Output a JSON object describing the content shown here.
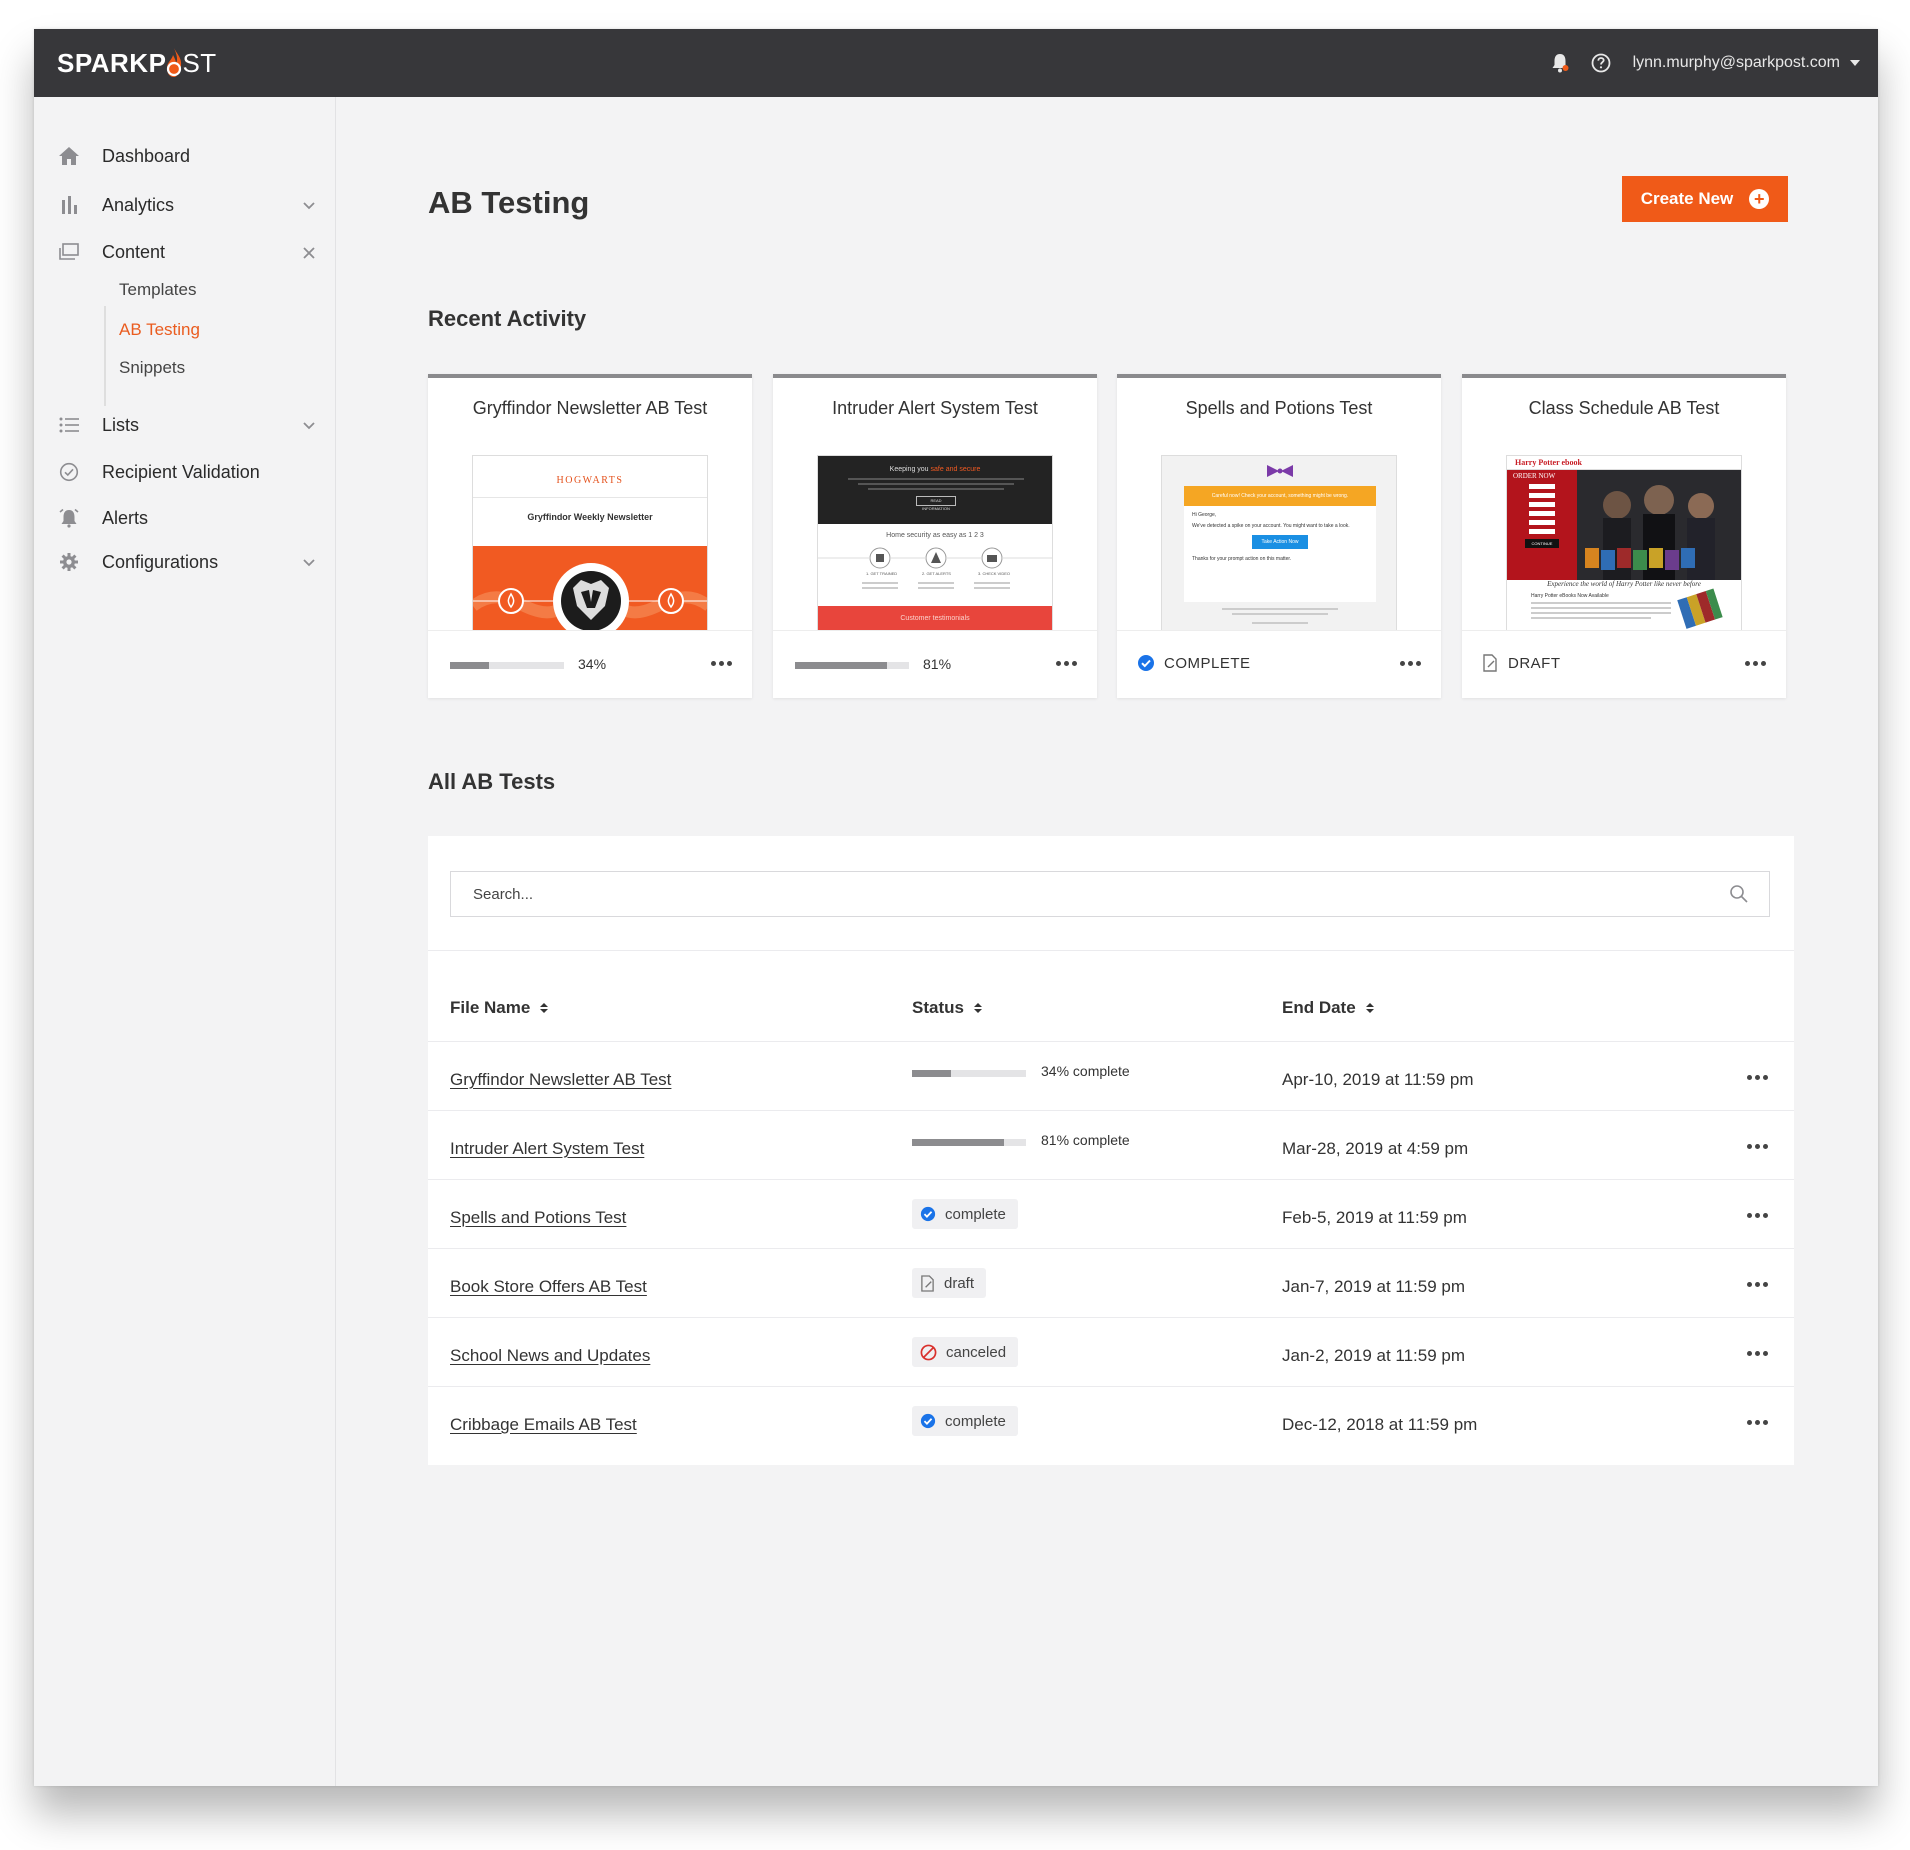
{
  "header": {
    "logo_left": "SPARKP",
    "logo_right": "ST",
    "user_email": "lynn.murphy@sparkpost.com",
    "icons": [
      "bell-icon",
      "help-icon"
    ]
  },
  "sidebar": {
    "items": [
      {
        "label": "Dashboard",
        "icon": "home-icon"
      },
      {
        "label": "Analytics",
        "icon": "bar-chart-icon"
      },
      {
        "label": "Content",
        "icon": "content-icon"
      },
      {
        "label": "Lists",
        "icon": "list-icon"
      },
      {
        "label": "Recipient Validation",
        "icon": "check-circle-icon"
      },
      {
        "label": "Alerts",
        "icon": "alarm-icon"
      },
      {
        "label": "Configurations",
        "icon": "gear-icon"
      }
    ],
    "content_sub": [
      "Templates",
      "AB Testing",
      "Snippets"
    ]
  },
  "page": {
    "title": "AB Testing",
    "create_label": "Create New",
    "recent_heading": "Recent Activity",
    "all_heading": "All AB Tests"
  },
  "cards": [
    {
      "title": "Gryffindor Newsletter AB Test",
      "progress": 34,
      "progress_label": "34%"
    },
    {
      "title": "Intruder Alert System Test",
      "progress": 81,
      "progress_label": "81%"
    },
    {
      "title": "Spells and Potions Test",
      "status": "COMPLETE"
    },
    {
      "title": "Class Schedule AB Test",
      "status": "DRAFT"
    }
  ],
  "thumbs": {
    "t1": {
      "brand": "HOGWARTS",
      "headline": "Gryffindor Weekly Newsletter"
    },
    "t2": {
      "headline_a": "Keeping you ",
      "headline_b": "safe and secure",
      "button": "READ INFORMATION",
      "mid": "Home security as easy as 1 2 3",
      "col1": "1. GET TRAINED",
      "col2": "2. GET ALERTS",
      "col3": "3. CHECK VIDEO",
      "footer": "Customer testimonials"
    },
    "t3": {
      "banner": "Careful now! Check your account, something might be wrong.",
      "greeting": "Hi George,",
      "body": "We've detected a spike on your account. You might want to take a look.",
      "button": "Take Action Now",
      "thanks": "Thanks for your prompt action on this matter."
    },
    "t4": {
      "brand": "Harry Potter ebook",
      "order": "ORDER NOW",
      "continue": "CONTINUE",
      "tagline": "Experience the world of Harry Potter like never before",
      "sub": "Harry Potter eBooks Now Available"
    }
  },
  "search": {
    "placeholder": "Search..."
  },
  "table": {
    "columns": [
      "File Name",
      "Status",
      "End Date"
    ],
    "rows": [
      {
        "name": "Gryffindor Newsletter AB Test",
        "progress": 34,
        "status_text": "34% complete",
        "end_date": "Apr-10, 2019 at 11:59 pm"
      },
      {
        "name": "Intruder Alert System Test",
        "progress": 81,
        "status_text": "81% complete",
        "end_date": "Mar-28, 2019 at 4:59 pm"
      },
      {
        "name": "Spells and Potions Test",
        "status": "complete",
        "end_date": "Feb-5, 2019 at 11:59 pm"
      },
      {
        "name": "Book Store Offers AB Test",
        "status": "draft",
        "end_date": "Jan-7, 2019 at 11:59 pm"
      },
      {
        "name": "School News and Updates",
        "status": "canceled",
        "end_date": "Jan-2, 2019 at 11:59 pm"
      },
      {
        "name": "Cribbage Emails AB Test",
        "status": "complete",
        "end_date": "Dec-12, 2018 at 11:59 pm"
      }
    ]
  },
  "colors": {
    "accent": "#f05a18",
    "topbar": "#37373a",
    "complete_blue": "#1a73e8",
    "canceled_red": "#d9302c"
  }
}
